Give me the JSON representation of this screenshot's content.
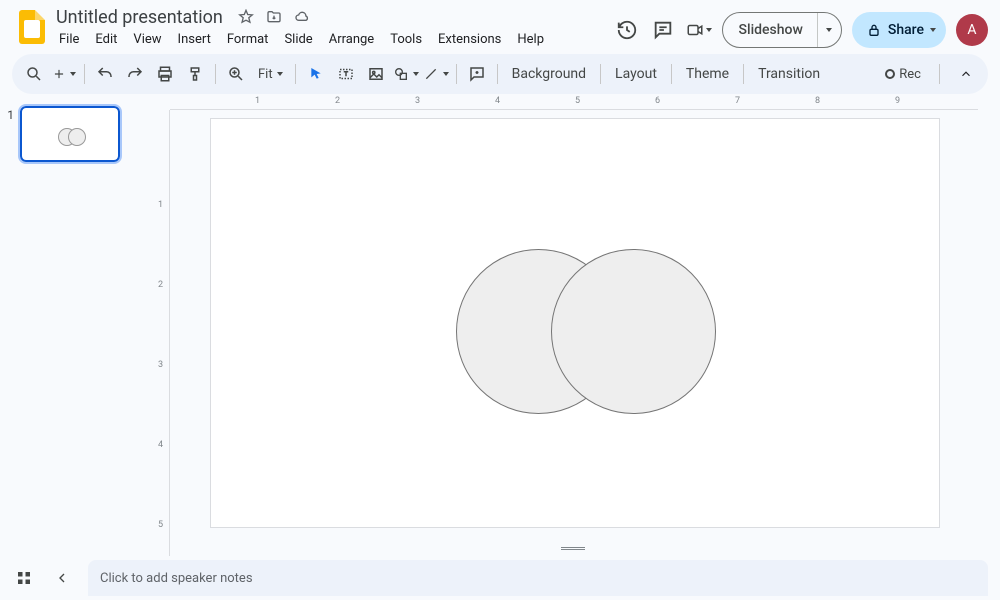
{
  "header": {
    "title": "Untitled presentation",
    "menus": [
      "File",
      "Edit",
      "View",
      "Insert",
      "Format",
      "Slide",
      "Arrange",
      "Tools",
      "Extensions",
      "Help"
    ],
    "slideshow": "Slideshow",
    "share": "Share",
    "avatar": "A"
  },
  "toolbar": {
    "zoom": "Fit",
    "background": "Background",
    "layout": "Layout",
    "theme": "Theme",
    "transition": "Transition",
    "rec": "Rec"
  },
  "ruler": {
    "h": [
      "1",
      "2",
      "3",
      "4",
      "5",
      "6",
      "7",
      "8",
      "9"
    ],
    "v": [
      "1",
      "2",
      "3",
      "4",
      "5"
    ]
  },
  "thumb": {
    "num": "1"
  },
  "notes": {
    "placeholder": "Click to add speaker notes"
  }
}
